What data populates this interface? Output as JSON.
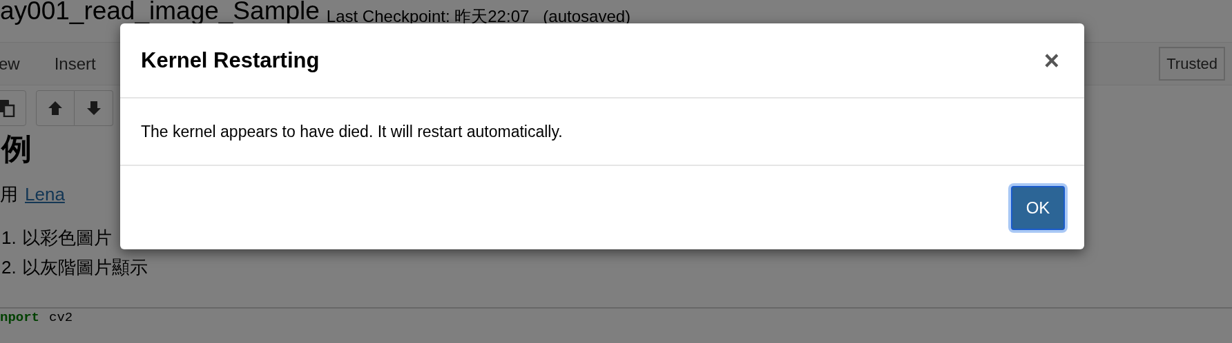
{
  "notebook": {
    "title": "ay001_read_image_Sample",
    "checkpoint": "Last Checkpoint: 昨天22:07",
    "autosave": "(autosaved)"
  },
  "menu": [
    {
      "label": "ew"
    },
    {
      "label": "Insert"
    }
  ],
  "trusted": "Trusted",
  "toolbar": [
    {
      "kind": "paste"
    },
    {
      "kind": "up"
    },
    {
      "kind": "down"
    }
  ],
  "cell": {
    "heading": "例",
    "intro": "用",
    "link": "Lena",
    "list": [
      {
        "number": "1.",
        "text": "以彩色圖片"
      },
      {
        "number": "2.",
        "text": "以灰階圖片顯示"
      }
    ]
  },
  "code": [
    {
      "kind": "keyword",
      "text": "nport"
    },
    {
      "kind": "name",
      "text": "cv2"
    }
  ],
  "dialog": {
    "title": "Kernel Restarting",
    "close": "×",
    "message": "The kernel appears to have died. It will restart automatically.",
    "buttons": [
      {
        "label": "OK",
        "focused": true
      }
    ]
  }
}
